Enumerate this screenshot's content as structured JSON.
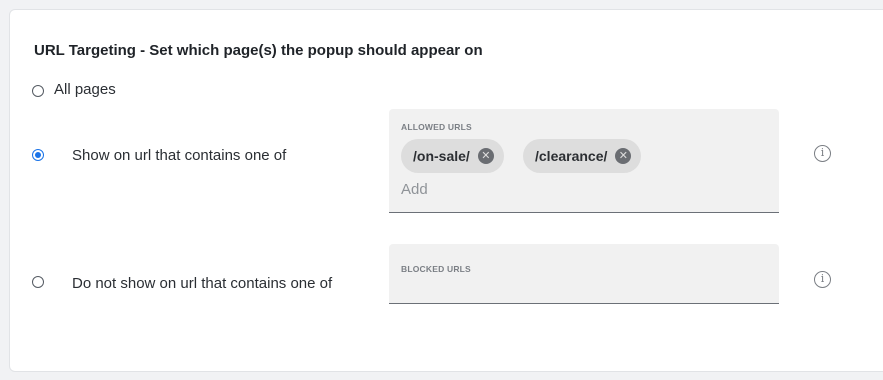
{
  "section": {
    "title": "URL Targeting - Set which page(s) the popup should appear on"
  },
  "options": {
    "all_pages": {
      "label": "All pages",
      "selected": false
    },
    "show_on": {
      "label": "Show on url that contains one of",
      "selected": true
    },
    "do_not_show": {
      "label": "Do not show on url that contains one of",
      "selected": false
    }
  },
  "allowed_urls": {
    "label": "ALLOWED URLS",
    "chips": [
      "/on-sale/",
      "/clearance/"
    ],
    "placeholder": "Add",
    "value": ""
  },
  "blocked_urls": {
    "label": "BLOCKED URLS",
    "chips": [],
    "value": ""
  },
  "icons": {
    "chip_remove": "close-circle-icon",
    "info": "info-icon"
  },
  "colors": {
    "accent": "#1a73e8",
    "field_bg": "#f1f1f1",
    "chip_bg": "#dddddd"
  }
}
